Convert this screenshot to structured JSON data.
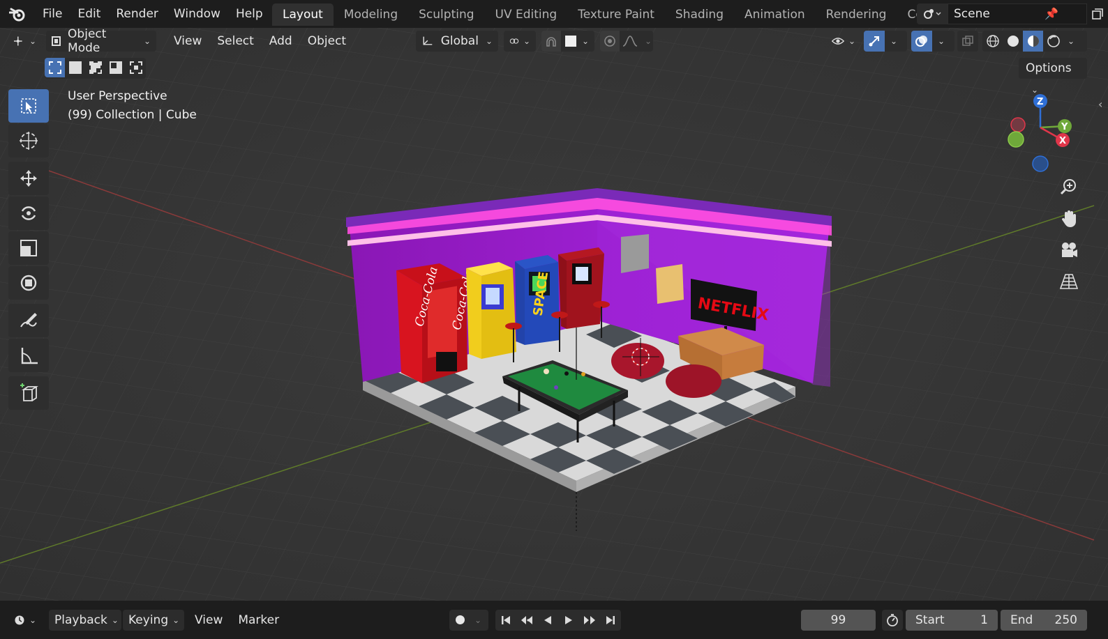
{
  "topbar": {
    "menus": [
      "File",
      "Edit",
      "Render",
      "Window",
      "Help"
    ],
    "workspace_tabs": [
      {
        "label": "Layout",
        "active": true
      },
      {
        "label": "Modeling",
        "active": false
      },
      {
        "label": "Sculpting",
        "active": false
      },
      {
        "label": "UV Editing",
        "active": false
      },
      {
        "label": "Texture Paint",
        "active": false
      },
      {
        "label": "Shading",
        "active": false
      },
      {
        "label": "Animation",
        "active": false
      },
      {
        "label": "Rendering",
        "active": false
      },
      {
        "label": "Compo",
        "active": false
      }
    ],
    "scene_name": "Scene"
  },
  "viewport_header": {
    "mode": "Object Mode",
    "menus": [
      "View",
      "Select",
      "Add",
      "Object"
    ],
    "orientation": "Global",
    "options_label": "Options"
  },
  "viewport": {
    "perspective_label": "User Perspective",
    "collection_label": "(99) Collection | Cube",
    "gizmo_axes": {
      "z": "Z",
      "y": "Y",
      "x": "X"
    },
    "scene_texts": {
      "vending": "Coca-Cola",
      "arcade": "SPACE",
      "tv": "NETFLIX"
    }
  },
  "timeline": {
    "menus": [
      "Playback",
      "Keying",
      "View",
      "Marker"
    ],
    "current_frame": "99",
    "start_label": "Start",
    "start_value": "1",
    "end_label": "End",
    "end_value": "250"
  },
  "colors": {
    "accent": "#4772b3",
    "background": "#393939",
    "header": "#1d1d1d",
    "neon_purple": "#9b17c9",
    "neon_pink": "#ff6fd2"
  }
}
